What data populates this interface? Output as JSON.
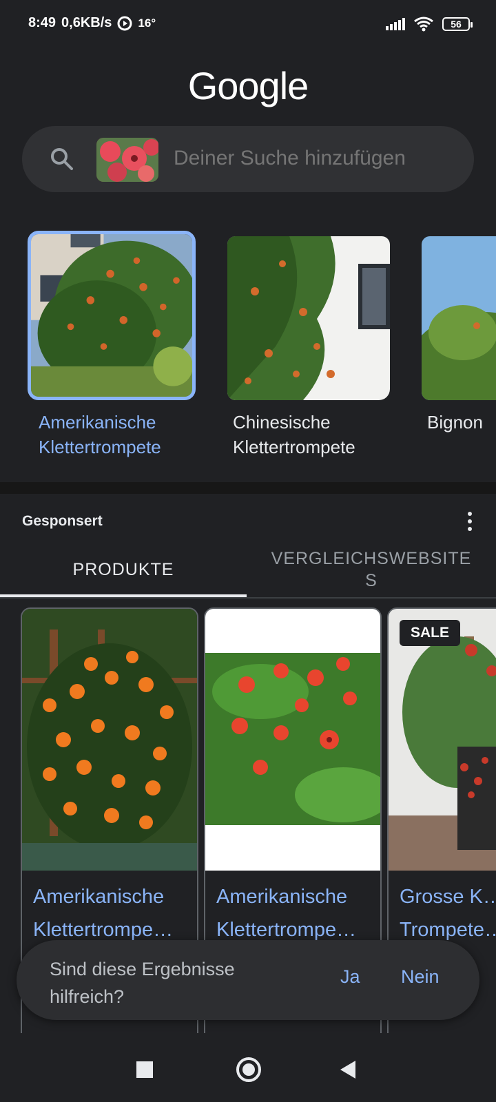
{
  "status": {
    "time": "8:49",
    "speed": "0,6KB/s",
    "temp": "16°",
    "battery": "56"
  },
  "google_logo": "Google",
  "search": {
    "placeholder": "Deiner Suche hinzufügen"
  },
  "related": [
    {
      "label": "Amerikanische Klettertrompete",
      "selected": true
    },
    {
      "label": "Chinesische Klettertrompete",
      "selected": false
    },
    {
      "label": "Bignon",
      "selected": false
    }
  ],
  "sponsored": {
    "label": "Gesponsert",
    "tabs": [
      "PRODUKTE",
      "VERGLEICHSWEBSITES"
    ],
    "products": [
      {
        "title": "Amerikanische Klettertrompe…"
      },
      {
        "title": "Amerikanische Klettertrompe…"
      },
      {
        "title": "Grosse K… Trompete…",
        "badge": "SALE"
      }
    ]
  },
  "feedback": {
    "question": "Sind diese Ergebnisse hilfreich?",
    "yes": "Ja",
    "no": "Nein"
  },
  "colors": {
    "background": "#202124",
    "accent": "#8ab4f8",
    "search_bg": "#303134"
  }
}
